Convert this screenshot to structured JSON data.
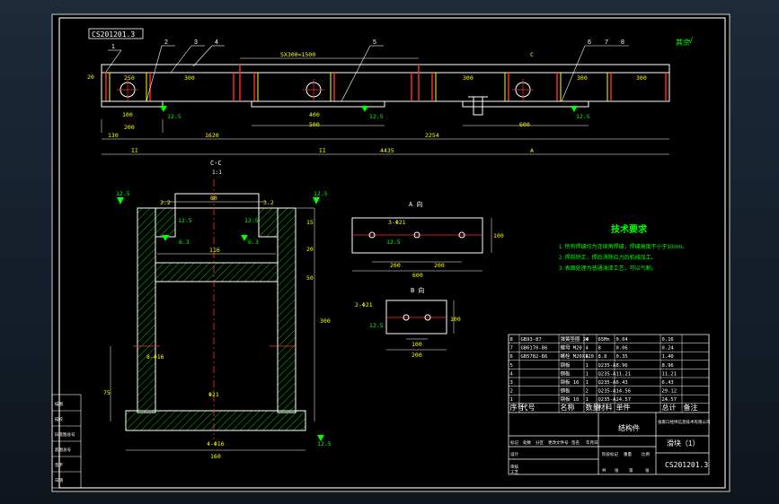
{
  "drawing": {
    "code_stamp": "CS201201.3",
    "callouts": [
      "1",
      "2",
      "3",
      "4",
      "5",
      "6",
      "7",
      "8"
    ],
    "roughness_mark": "√",
    "roughness_other": "其余",
    "top_dims": {
      "span_label": "5X300=1500",
      "d1": "250",
      "d2": "300",
      "d3": "300",
      "d4": "300",
      "d5": "300",
      "d6": "300",
      "h": "20",
      "pitch1": "100",
      "pitch2": "200",
      "w1": "400",
      "w2": "500",
      "w3": "600",
      "w4": "200",
      "r1": "12.5",
      "r2": "12.5",
      "r3": "12.5",
      "ov1": "130",
      "ov2": "1620",
      "ov3": "2254",
      "ov4": "4435",
      "sec1": "II",
      "sec2": "II",
      "secA": "A",
      "secC": "C"
    },
    "section_cc": {
      "title": "C-C",
      "scale": "1:1",
      "w_top": "80",
      "w_mid": "116",
      "w_bot": "160",
      "h_total": "300",
      "h1": "15",
      "h2": "20",
      "h3": "50",
      "h4": "75",
      "hole": "Φ21",
      "bolt1": "4-Φ16",
      "bolt2": "8-Φ16",
      "r_a": "12.5",
      "r_b": "12.5",
      "r_c": "12.5",
      "r_d": "6.3",
      "r_e": "6.3",
      "r_f": "12.5",
      "r_g": "12.5",
      "ang1": "3.2",
      "ang2": "3.2"
    },
    "view_a": {
      "title": "A 向",
      "holes": "3-Φ21",
      "r": "12.5",
      "d1": "200",
      "d2": "200",
      "total": "600",
      "h": "100"
    },
    "view_b": {
      "title": "B 向",
      "holes": "2-Φ21",
      "r": "12.5",
      "d1": "100",
      "total": "200",
      "h": "100"
    },
    "tech": {
      "title": "技术要求",
      "items": [
        "1. 所有焊缝均为连续角焊缝，焊缝高度不小于10mm。",
        "2. 焊前矫正，焊后消除应力后机械加工。",
        "3. 表面处理为普通油漆工艺，可以气割。"
      ]
    },
    "bom": {
      "rows": [
        [
          "8",
          "GB93-87",
          "弹簧垫圈 20",
          "4",
          "65Mn",
          "0.04",
          "0.16",
          ""
        ],
        [
          "7",
          "GB6170-86",
          "螺母 M20",
          "4",
          "8",
          "0.06",
          "0.24",
          ""
        ],
        [
          "6",
          "GB5782-86",
          "螺栓 M20X120",
          "4",
          "8.8",
          "0.35",
          "1.40",
          ""
        ],
        [
          "5",
          "",
          "钢板",
          "1",
          "Q235-A",
          "8.96",
          "8.96",
          ""
        ],
        [
          "4",
          "",
          "钢板",
          "1",
          "Q235-A",
          "11.21",
          "11.21",
          ""
        ],
        [
          "3",
          "",
          "钢板 16",
          "1",
          "Q235-A",
          "6.43",
          "6.43",
          ""
        ],
        [
          "2",
          "",
          "钢板",
          "2",
          "Q235-A",
          "14.56",
          "29.12",
          ""
        ],
        [
          "1",
          "",
          "钢板 10",
          "1",
          "Q235-A",
          "24.57",
          "24.57",
          ""
        ]
      ],
      "headers": [
        "序号",
        "代号",
        "名称",
        "数量",
        "材料",
        "单件",
        "总计",
        "备注"
      ],
      "title": "结构件",
      "part_name": "滑块（1）",
      "drawing_no": "CS201201.3",
      "company": "张家口经纬信息技术有限公司",
      "labels": [
        "设计",
        "审核",
        "工艺",
        "标记",
        "处数",
        "分区",
        "更改文件号",
        "签名",
        "年月日",
        "阶段标记",
        "重量",
        "比例",
        "共",
        "张",
        "第",
        "张"
      ]
    },
    "left_stamp": [
      "描图",
      "描校",
      "旧底图总号",
      "底图总号",
      "签字",
      "日期"
    ]
  }
}
